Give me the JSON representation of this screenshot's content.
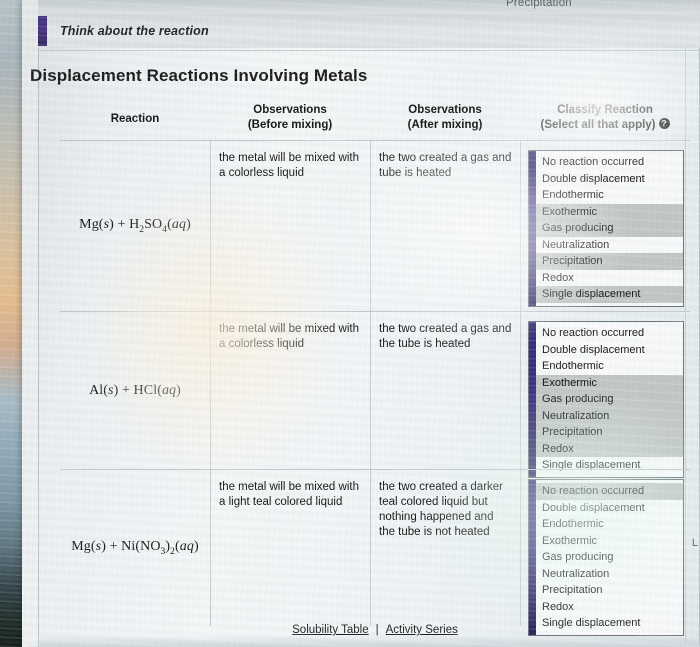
{
  "window": {
    "top_cut_tab_label": "Precipitation",
    "edge_glyph": "L"
  },
  "banner": {
    "label": "Think about the reaction",
    "accent_color": "#3b2f7a"
  },
  "page": {
    "heading": "Displacement Reactions Involving Metals"
  },
  "table": {
    "headers": {
      "reaction": "Reaction",
      "before_line1": "Observations",
      "before_line2": "(Before mixing)",
      "after_line1": "Observations",
      "after_line2": "(After mixing)",
      "classify_line1": "Classify Reaction",
      "classify_line2": "(Select all that apply)",
      "help_icon_glyph": "?"
    },
    "option_labels": [
      "No reaction occurred",
      "Double displacement",
      "Endothermic",
      "Exothermic",
      "Gas producing",
      "Neutralization",
      "Precipitation",
      "Redox",
      "Single displacement"
    ],
    "rows": [
      {
        "equation_html": "Mg(<i>s</i>) + H<sub>2</sub>SO<sub>4</sub>(<i>aq</i>)",
        "equation_text": "Mg(s) + H2SO4(aq)",
        "before": "the metal will be mixed with a colorless liquid",
        "after": "the two created a gas and tube is heated",
        "selected": [
          false,
          false,
          false,
          true,
          true,
          false,
          true,
          false,
          true
        ]
      },
      {
        "equation_html": "Al(<i>s</i>) + HCl(<i>aq</i>)",
        "equation_text": "Al(s) + HCl(aq)",
        "before": "the metal will be mixed with a colorless liquid",
        "after": "the two created a gas and the tube is heated",
        "selected": [
          false,
          false,
          false,
          true,
          true,
          true,
          true,
          true,
          false
        ]
      },
      {
        "equation_html": "Mg(<i>s</i>) + Ni(NO<sub>3</sub>)<sub>2</sub>(<i>aq</i>)",
        "equation_text": "Mg(s) + Ni(NO3)2(aq)",
        "before": "the metal will be mixed with a light teal colored liquid",
        "after": "the two created a darker teal colored liquid but nothing happened and the tube is not heated",
        "selected": [
          true,
          false,
          false,
          false,
          false,
          false,
          false,
          false,
          false
        ]
      }
    ]
  },
  "footer": {
    "solubility_link": "Solubility Table",
    "separator": "|",
    "activity_link": "Activity Series"
  },
  "colors": {
    "selected_option_bg": "#c3c8c5",
    "listbox_rail": "#3a2a86",
    "page_bg": "#f2f6f7"
  }
}
